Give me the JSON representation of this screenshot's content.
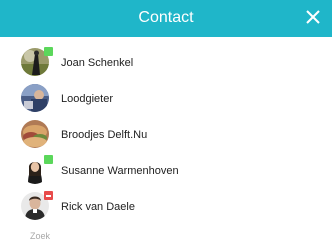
{
  "header": {
    "title": "Contact",
    "background": "#1fb6c9",
    "close_icon": "close-icon"
  },
  "contacts": [
    {
      "name": "Joan Schenkel",
      "status": "online",
      "status_color": "#5bd75b"
    },
    {
      "name": "Loodgieter",
      "status": "none"
    },
    {
      "name": "Broodjes Delft.Nu",
      "status": "none"
    },
    {
      "name": "Susanne Warmenhoven",
      "status": "online",
      "status_color": "#5bd75b"
    },
    {
      "name": "Rick van Daele",
      "status": "do-not-disturb",
      "status_color": "#e84b4b"
    }
  ],
  "search": {
    "placeholder": "Zoek"
  }
}
